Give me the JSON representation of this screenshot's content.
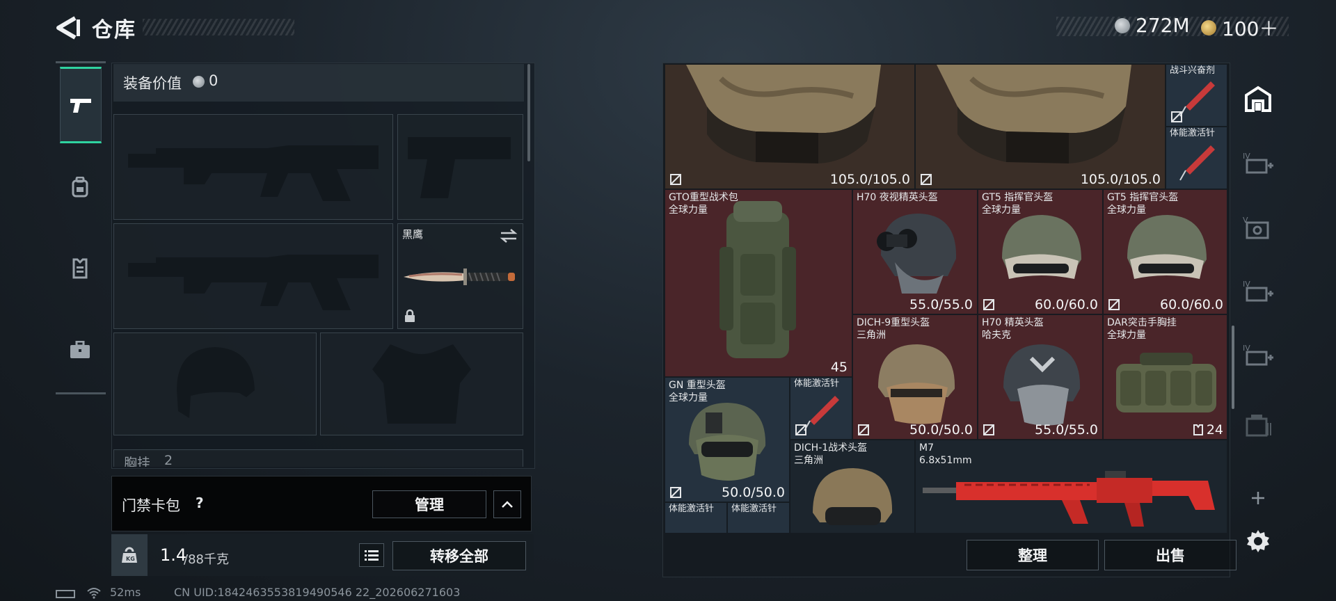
{
  "header": {
    "title": "仓库",
    "currencies": [
      {
        "icon": "silver-coin-icon",
        "value": "272M"
      },
      {
        "icon": "gold-coin-icon",
        "value": "100＋"
      }
    ]
  },
  "equipment": {
    "value_label": "装备价值",
    "value_amount": "0",
    "melee_name": "黑鹰",
    "partial_section_label": "胸挂",
    "partial_section_count": "2"
  },
  "keycard": {
    "label": "门禁卡包",
    "help": "?",
    "manage_label": "管理"
  },
  "weight": {
    "current": "1.4",
    "capacity": "/88千克",
    "transfer_all_label": "转移全部"
  },
  "inventory": {
    "items": [
      {
        "id": "armor1",
        "label": "",
        "value": "105.0/105.0"
      },
      {
        "id": "armor2",
        "label": "",
        "value": "105.0/105.0"
      },
      {
        "id": "stim1",
        "label": "战斗兴奋剂",
        "value": ""
      },
      {
        "id": "stim2",
        "label": "体能激活针",
        "value": ""
      },
      {
        "id": "gto",
        "label": "GTO重型战术包\n全球力量",
        "value": "45"
      },
      {
        "id": "h70nv",
        "label": "H70 夜视精英头盔",
        "value": "55.0/55.0"
      },
      {
        "id": "gt5a",
        "label": "GT5 指挥官头盔\n全球力量",
        "value": "60.0/60.0"
      },
      {
        "id": "gt5b",
        "label": "GT5 指挥官头盔\n全球力量",
        "value": "60.0/60.0"
      },
      {
        "id": "dich9",
        "label": "DICH-9重型头盔\n三角洲",
        "value": "50.0/50.0"
      },
      {
        "id": "h70",
        "label": "H70 精英头盔\n哈夫克",
        "value": "55.0/55.0"
      },
      {
        "id": "dar",
        "label": "DAR突击手胸挂\n全球力量",
        "value": "24"
      },
      {
        "id": "gn",
        "label": "GN 重型头盔\n全球力量",
        "value": "50.0/50.0"
      },
      {
        "id": "stim3",
        "label": "体能激活针",
        "value": ""
      },
      {
        "id": "dich1",
        "label": "DICH-1战术头盔\n三角洲",
        "value": ""
      },
      {
        "id": "m7",
        "label": "M7\n6.8x51mm",
        "value": ""
      },
      {
        "id": "stim4",
        "label": "体能激活针",
        "value": ""
      },
      {
        "id": "stim5",
        "label": "体能激活针",
        "value": ""
      }
    ],
    "sort_label": "整理",
    "sell_label": "出售"
  },
  "status": {
    "ping": "52ms",
    "uid": "CN UID:1842463553819490546 22_202606271603"
  },
  "colors": {
    "accent": "#2fd3a0",
    "cell_brown": "#3a2e27",
    "cell_red": "#4a2529",
    "cell_blue": "#25323f",
    "weapon_red": "#d8302c"
  }
}
